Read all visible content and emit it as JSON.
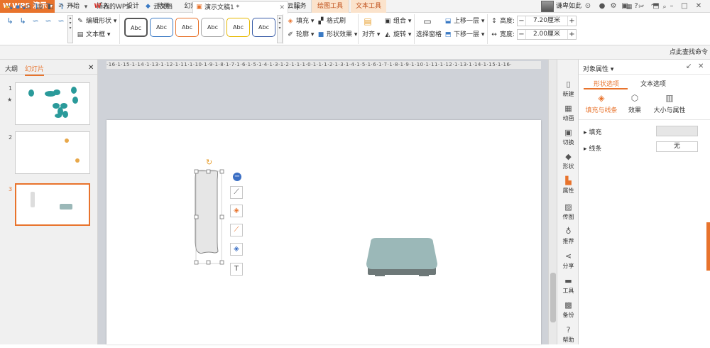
{
  "app": {
    "name": "WPS 演示"
  },
  "menu": {
    "tabs": [
      "开始",
      "插入",
      "设计",
      "动画",
      "幻灯片放映",
      "审阅",
      "视图",
      "云服务",
      "绘图工具",
      "文本工具"
    ],
    "user_name": "谦卑如此"
  },
  "ribbon": {
    "edit_shape": "编辑形状",
    "textbox": "文本框",
    "style_sample": "Abc",
    "fill": "填充",
    "format_painter": "格式刷",
    "outline": "轮廓",
    "shape_effects": "形状效果",
    "align": "对齐",
    "group": "组合",
    "rotate": "旋转",
    "selection_pane": "选择窗格",
    "bring_forward": "上移一层",
    "send_backward": "下移一层",
    "height_label": "高度:",
    "height_value": "7.20厘米",
    "width_label": "宽度:",
    "width_value": "2.00厘米"
  },
  "qat": {
    "doc_tabs": [
      "我的WPS",
      "云文档",
      "演示文稿1 *"
    ],
    "add_tab": "+",
    "search_cmd": "点此查找命令"
  },
  "left_panel": {
    "tab_outline": "大纲",
    "tab_slides": "幻灯片",
    "slides": [
      "1",
      "2",
      "3"
    ],
    "star": "★"
  },
  "ruler_text": "·16·1·15·1·14·1·13·1·12·1·11·1·10·1·9·1·8·1·7·1·6·1·5·1·4·1·3·1·2·1·1·1·0·1·1·1·2·1·3·1·4·1·5·1·6·1·7·1·8·1·9·1·10·1·11·1·12·1·13·1·14·1·15·1·16·",
  "side_strip": [
    "新建",
    "动画",
    "切换",
    "形状",
    "属性",
    "传图",
    "推荐",
    "分享",
    "工具",
    "备份",
    "帮助"
  ],
  "property_panel": {
    "title": "对象属性",
    "tab_shape": "形状选项",
    "tab_text": "文本选项",
    "sub_fill_line": "填充与线条",
    "sub_effects": "效果",
    "sub_size": "大小与属性",
    "fill_label": "填充",
    "line_label": "线条",
    "line_value": "无"
  },
  "colors": {
    "accent": "#e8732c",
    "shape_fill": "#9bb8b8",
    "teal": "#2a9a9a"
  }
}
